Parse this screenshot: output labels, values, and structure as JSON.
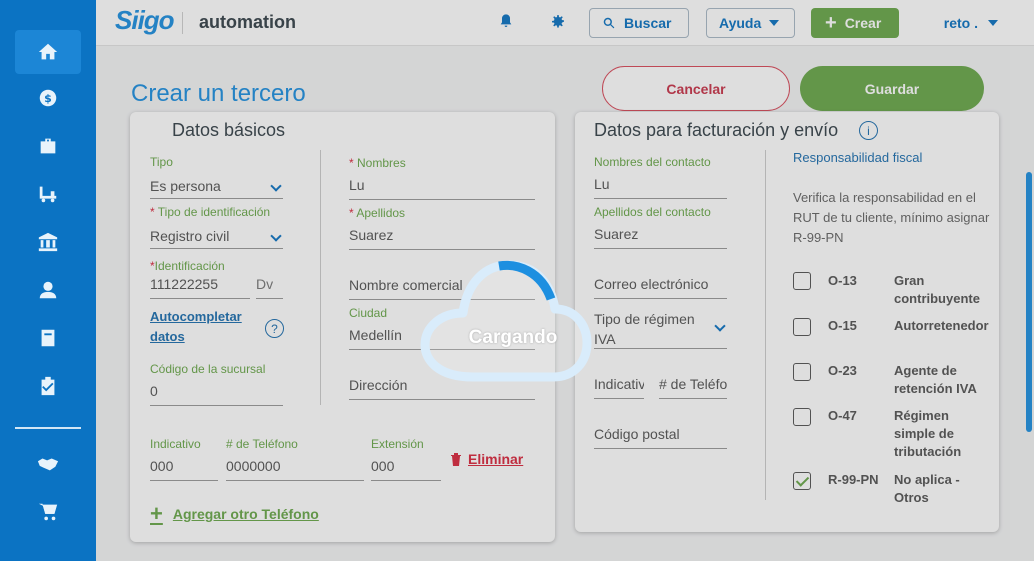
{
  "header": {
    "logo": "Siigo",
    "app_name": "automation",
    "search_label": "Buscar",
    "help_label": "Ayuda",
    "create_label": "Crear",
    "user_label": "reto ."
  },
  "sidebar": {
    "items": [
      "home-icon",
      "dollar-icon",
      "briefcase-icon",
      "forklift-icon",
      "bank-icon",
      "user-icon",
      "book-icon",
      "clipboard-check-icon",
      "handshake-icon",
      "cart-icon"
    ]
  },
  "page": {
    "title": "Crear un tercero",
    "cancel_label": "Cancelar",
    "save_label": "Guardar"
  },
  "basic": {
    "title": "Datos básicos",
    "tipo_label": "Tipo",
    "tipo_value": "Es persona",
    "tipo_id_label": "Tipo de identificación",
    "tipo_id_value": "Registro civil",
    "identificacion_label": "Identificación",
    "identificacion_value": "111222255",
    "dv_placeholder": "Dv",
    "autocompletar_label": "Autocompletar datos",
    "codigo_sucursal_label": "Código de la sucursal",
    "codigo_sucursal_value": "0",
    "nombres_label": "Nombres",
    "nombres_value": "Lu",
    "apellidos_label": "Apellidos",
    "apellidos_value": "Suarez",
    "nombre_comercial_placeholder": "Nombre comercial",
    "ciudad_label": "Ciudad",
    "ciudad_value": "Medellín",
    "direccion_placeholder": "Dirección",
    "indicativo_label": "Indicativo",
    "indicativo_value": "000",
    "telefono_label": "# de Teléfono",
    "telefono_value": "0000000",
    "extension_label": "Extensión",
    "extension_value": "000",
    "eliminar_label": "Eliminar",
    "agregar_label": "Agregar otro Teléfono"
  },
  "billing": {
    "title": "Datos para facturación y envío",
    "nombres_contacto_label": "Nombres del contacto",
    "nombres_contacto_value": "Lu",
    "apellidos_contacto_label": "Apellidos del contacto",
    "apellidos_contacto_value": "Suarez",
    "correo_placeholder": "Correo electrónico",
    "regimen_label": "Tipo de régimen",
    "regimen_value": "IVA",
    "indicativo_placeholder": "Indicativo",
    "telefono_placeholder": "# de Teléfono",
    "codigo_postal_placeholder": "Código postal",
    "resp_title": "Responsabilidad fiscal",
    "resp_desc": "Verifica la responsabilidad en el RUT de tu cliente, mínimo asignar R-99-PN",
    "responsibilities": [
      {
        "code": "O-13",
        "desc": "Gran contribuyente",
        "checked": false
      },
      {
        "code": "O-15",
        "desc": "Autorretenedor",
        "checked": false
      },
      {
        "code": "O-23",
        "desc": "Agente de retención IVA",
        "checked": false
      },
      {
        "code": "O-47",
        "desc": "Régimen simple de tributación",
        "checked": false
      },
      {
        "code": "R-99-PN",
        "desc": "No aplica - Otros",
        "checked": true
      }
    ]
  },
  "loading": {
    "text": "Cargando"
  },
  "colors": {
    "brand_blue": "#0b73c3",
    "accent_green": "#6aa84a",
    "danger": "#d9283e"
  }
}
